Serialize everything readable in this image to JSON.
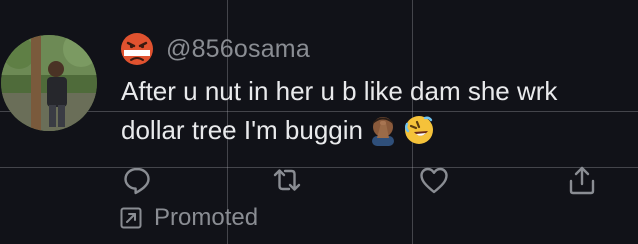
{
  "tweet": {
    "handle": "@856osama",
    "text_line_1": "After u nut in her u b like dam she wrk",
    "text_line_2": "dollar tree I'm buggin",
    "promoted_label": "Promoted",
    "avatar_icon": "user-photo-avatar",
    "handle_emoji": "angry-face-icon",
    "inline_emojis": [
      "man-facepalming-icon",
      "rolling-on-the-floor-laughing-icon"
    ]
  },
  "actions": [
    {
      "name": "reply",
      "icon": "reply-icon"
    },
    {
      "name": "retweet",
      "icon": "retweet-icon"
    },
    {
      "name": "like",
      "icon": "heart-icon"
    },
    {
      "name": "share",
      "icon": "share-icon"
    }
  ],
  "colors": {
    "background": "#111218",
    "text": "#e9eaec",
    "muted": "#8a8d93"
  }
}
